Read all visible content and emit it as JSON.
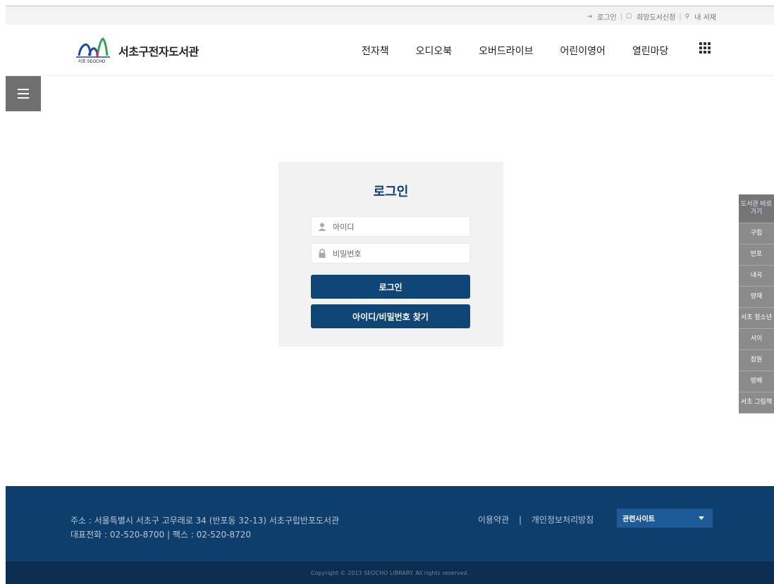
{
  "topbar": {
    "login": "로그인",
    "wish_book": "희망도서신청",
    "my_library": "내 서재"
  },
  "header": {
    "logo_text": "서초 SEOCHO",
    "site_title": "서초구전자도서관",
    "nav": [
      "전자책",
      "오디오북",
      "오버드라이브",
      "어린이영어",
      "열린마당"
    ]
  },
  "login": {
    "title": "로그인",
    "id_placeholder": "아이디",
    "pw_placeholder": "비밀번호",
    "login_button": "로그인",
    "find_button": "아이디/비밀번호 찾기"
  },
  "quick_menu": {
    "heading": "도서관 바로가기",
    "items": [
      "구립",
      "반포",
      "내곡",
      "양재",
      "서초 청소년",
      "서이",
      "잠원",
      "방배",
      "서초 그림책"
    ]
  },
  "footer": {
    "address": "주소 : 서울특별시 서초구 고무래로 34 (반포동 32-13) 서초구립반포도서관",
    "phone": "대표전화 : 02-520-8700 | 팩스 : 02-520-8720",
    "terms": "이용약관",
    "divider": "|",
    "privacy": "개인정보처리방침",
    "related_sites": "관련사이트",
    "copyright": "Copyright © 2013 SEOCHO LIBRARY. All rights reserved."
  },
  "colors": {
    "primary": "#0f4677",
    "footer_bg": "#0e3f6c",
    "footer_bottom": "#0b2d4f",
    "quick_bg": "#8b8b8b"
  }
}
